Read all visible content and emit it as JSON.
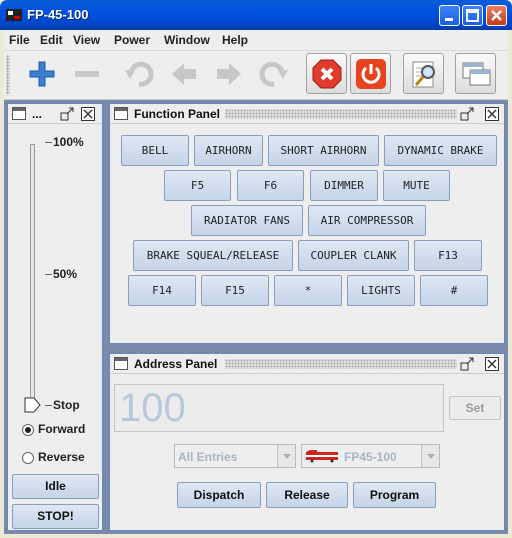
{
  "window": {
    "title": "FP-45-100"
  },
  "menu": {
    "items": [
      "File",
      "Edit",
      "View",
      "Power",
      "Window",
      "Help"
    ]
  },
  "toolbar": {
    "buttons": [
      "add-icon",
      "remove-icon",
      "undo-icon",
      "back-icon",
      "forward-icon",
      "redo-icon",
      "stop-all-icon",
      "power-icon",
      "edit-roster-icon",
      "windows-icon"
    ]
  },
  "throttle": {
    "title": "...",
    "speed_labels": [
      "100%",
      "50%",
      "Stop"
    ],
    "speed_level": 0,
    "direction": {
      "forward_label": "Forward",
      "reverse_label": "Reverse",
      "selected": "Forward"
    },
    "idle_label": "Idle",
    "stop_label": "STOP!"
  },
  "function_panel": {
    "title": "Function Panel",
    "rows": [
      [
        "BELL",
        "AIRHORN",
        "SHORT AIRHORN",
        "DYNAMIC BRAKE"
      ],
      [
        "F5",
        "F6",
        "DIMMER",
        "MUTE"
      ],
      [
        "RADIATOR FANS",
        "AIR COMPRESSOR"
      ],
      [
        "BRAKE SQUEAL/RELEASE",
        "COUPLER CLANK",
        "F13"
      ],
      [
        "F14",
        "F15",
        "*",
        "LIGHTS",
        "#"
      ]
    ]
  },
  "address_panel": {
    "title": "Address Panel",
    "address_value": "100",
    "set_label": "Set",
    "roster_group": "All Entries",
    "roster_entry": "FP45-100",
    "dispatch_label": "Dispatch",
    "release_label": "Release",
    "program_label": "Program"
  },
  "colors": {
    "titlebar": "#0151e0",
    "desktop": "#7b8ca8",
    "button_face": "#c5d4e8",
    "stop_red": "#e03a2c"
  }
}
